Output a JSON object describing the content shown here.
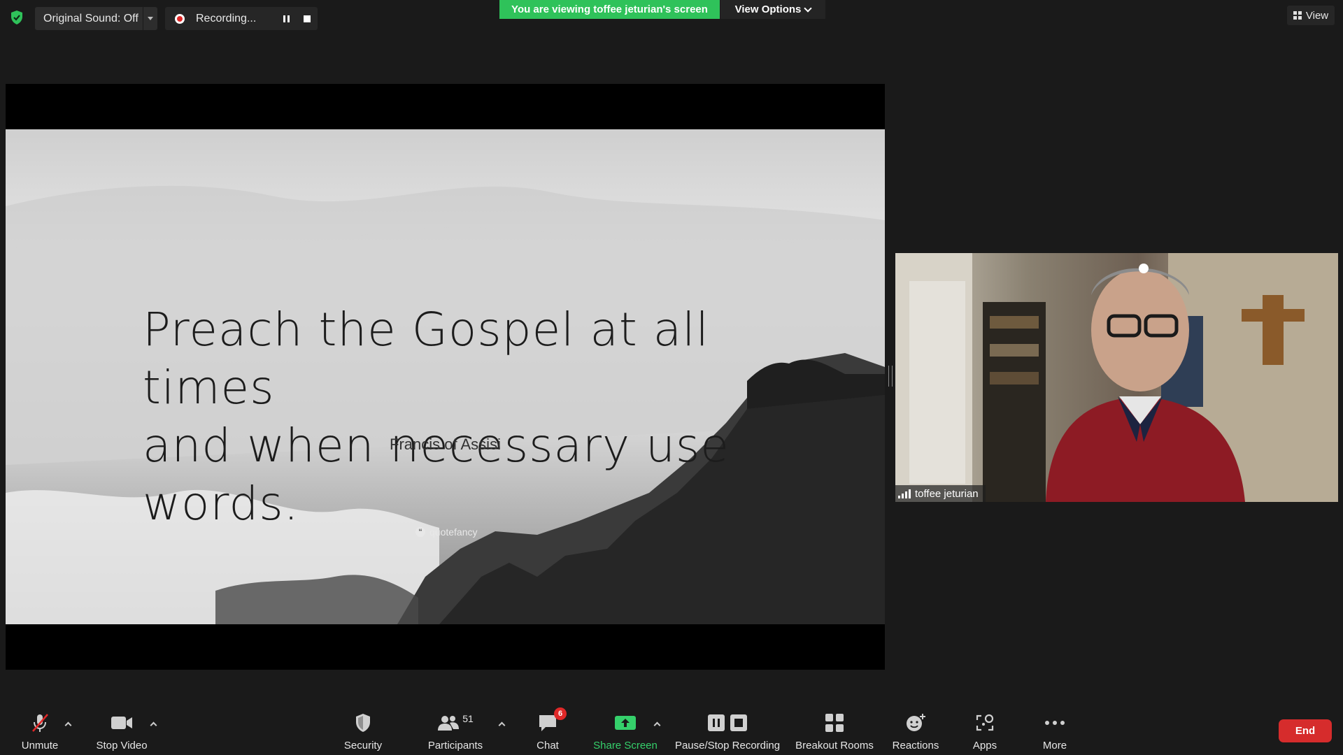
{
  "top_bar": {
    "original_sound_label": "Original Sound: Off",
    "recording_label": "Recording...",
    "viewing_banner": "You are viewing toffee jeturian's screen",
    "view_options_label": "View Options",
    "view_label": "View"
  },
  "shared_screen": {
    "quote_line_1": "Preach the Gospel at all times",
    "quote_line_2": "and when necessary use words.",
    "author": "Francis of Assisi",
    "watermark": "quotefancy"
  },
  "participant": {
    "name": "toffee jeturian"
  },
  "toolbar": {
    "unmute": "Unmute",
    "stop_video": "Stop Video",
    "security": "Security",
    "participants": "Participants",
    "participants_count": "51",
    "chat": "Chat",
    "chat_badge": "6",
    "share_screen": "Share Screen",
    "pause_stop_recording": "Pause/Stop Recording",
    "breakout_rooms": "Breakout Rooms",
    "reactions": "Reactions",
    "apps": "Apps",
    "more": "More",
    "end": "End"
  },
  "colors": {
    "accent_green": "#2fc25a",
    "end_red": "#d62c2c",
    "badge_red": "#e02828",
    "background": "#1a1a1a"
  },
  "icons": [
    "shield-check-icon",
    "record-icon",
    "pause-icon",
    "stop-icon",
    "grid-view-icon",
    "muted-mic-icon",
    "video-camera-icon",
    "security-shield-icon",
    "participants-icon",
    "chat-icon",
    "share-screen-icon",
    "pause-stop-recording-icon",
    "breakout-rooms-icon",
    "reactions-icon",
    "apps-icon",
    "more-icon",
    "signal-bars-icon"
  ]
}
